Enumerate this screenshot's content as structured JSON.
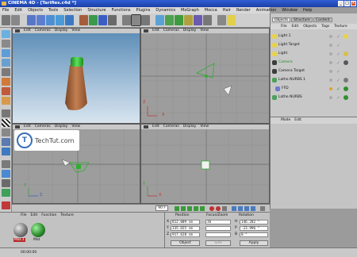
{
  "title": "CINEMA 4D - [Tarifies.c4d *]",
  "window_buttons": [
    "_",
    "□",
    "×"
  ],
  "menu": [
    "File",
    "Edit",
    "Objects",
    "Tools",
    "Selection",
    "Structure",
    "Functions",
    "Plugins",
    "Dynamics",
    "MoGraph",
    "Mocca",
    "Hair",
    "Render",
    "Animation",
    "Window",
    "Help"
  ],
  "viewport_menu": [
    "Edit",
    "Cameras",
    "Display",
    "View"
  ],
  "axes": {
    "x": "X",
    "y": "Y",
    "z": "Z"
  },
  "object_manager": {
    "tabs": [
      "Objects",
      "Structure",
      "Content"
    ],
    "menu": [
      "File",
      "Edit",
      "Objects",
      "Tags",
      "Texture"
    ],
    "objects": [
      {
        "name": "Light 1",
        "color": "#e8d24a"
      },
      {
        "name": "Light Target",
        "color": "#e8d24a"
      },
      {
        "name": "Light",
        "color": "#e8d24a"
      },
      {
        "name": "Camera",
        "color": "#3c3c3c"
      },
      {
        "name": "Camera Target",
        "color": "#3c3c3c"
      },
      {
        "name": "Lathe NURBS 1",
        "color": "#4ba05a"
      },
      {
        "name": "FFD",
        "color": "#6d7bd0"
      },
      {
        "name": "Lathe NURBS",
        "color": "#4ba05a"
      }
    ]
  },
  "attributes": {
    "menu": [
      "Mode",
      "Edit"
    ]
  },
  "timeline": {
    "frame": "90 F"
  },
  "materials": {
    "menu": [
      "File",
      "Edit",
      "Function",
      "Texture"
    ],
    "items": [
      {
        "label": "Mat.1",
        "color": "#7a7a7a"
      },
      {
        "label": "Mat",
        "color": "#2f8f2f"
      }
    ]
  },
  "coordinates": {
    "headers": [
      "Position",
      "Focus/Zoom",
      "Rotation"
    ],
    "rows": [
      {
        "axis": "X",
        "position": "812.009 cm",
        "zoom": "36",
        "rot_label": "H",
        "rotation": "146.282 °"
      },
      {
        "axis": "Y",
        "position": "335.655 cm",
        "zoom": "",
        "rot_label": "P",
        "rotation": "-23.996 °"
      },
      {
        "axis": "Z",
        "position": "917.628 cm",
        "zoom": "",
        "rot_label": "B",
        "rotation": "0 °"
      }
    ],
    "mode": "Object",
    "size": "Size",
    "apply": "Apply"
  },
  "status": "00:00:00",
  "watermark": {
    "logo": "T",
    "text": "TechTut.com"
  },
  "colors": {
    "accent": "#2f5fd6",
    "viewport_sky": "#5f8fb8",
    "tube": "#a8643c",
    "cap": "#2ea82e"
  }
}
